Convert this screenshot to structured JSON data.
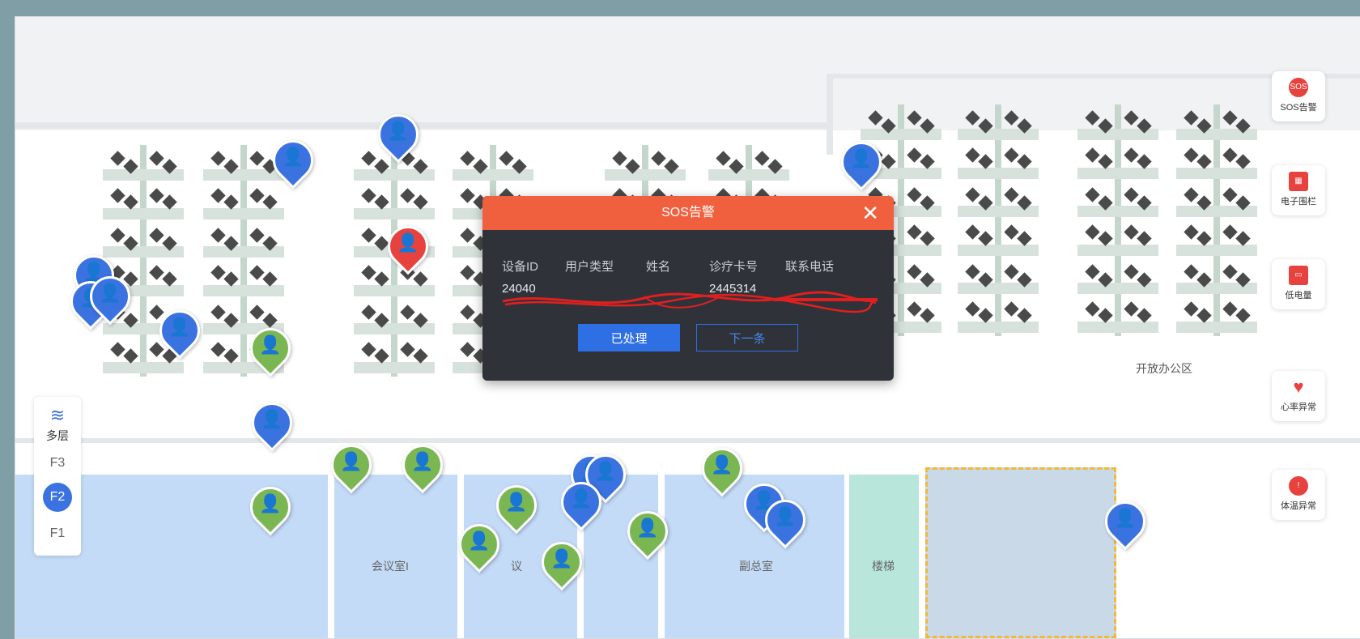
{
  "map": {
    "zone_label": "开放办公区",
    "room_meeting": "会议室I",
    "room_meeting2": "议",
    "room_vp": "副总室",
    "room_stairs": "楼梯"
  },
  "floor_selector": {
    "multi_label": "多层",
    "floors": [
      "F3",
      "F2",
      "F1"
    ],
    "active": "F2"
  },
  "side_buttons": [
    {
      "label": "SOS告警",
      "icon": "sos-icon",
      "icon_text": "SOS",
      "color": "#e8423f"
    },
    {
      "label": "电子围栏",
      "icon": "fence-icon",
      "icon_text": "▦",
      "color": "#e8423f"
    },
    {
      "label": "低电量",
      "icon": "battery-icon",
      "icon_text": "▭",
      "color": "#e8423f"
    },
    {
      "label": "心率异常",
      "icon": "heart-icon",
      "icon_text": "♥",
      "color": "#e8423f"
    },
    {
      "label": "体温异常",
      "icon": "thermometer-icon",
      "icon_text": "!",
      "color": "#e8423f"
    }
  ],
  "alert_modal": {
    "title": "SOS告警",
    "close": "✕",
    "headers": [
      "设备ID",
      "用户类型",
      "姓名",
      "诊疗卡号",
      "联系电话"
    ],
    "values": [
      "24040",
      "",
      "",
      "2445314",
      ""
    ],
    "btn_done": "已处理",
    "btn_next": "下一条"
  },
  "markers": {
    "patient_glyph": "👤",
    "staff_glyph": "👤"
  }
}
